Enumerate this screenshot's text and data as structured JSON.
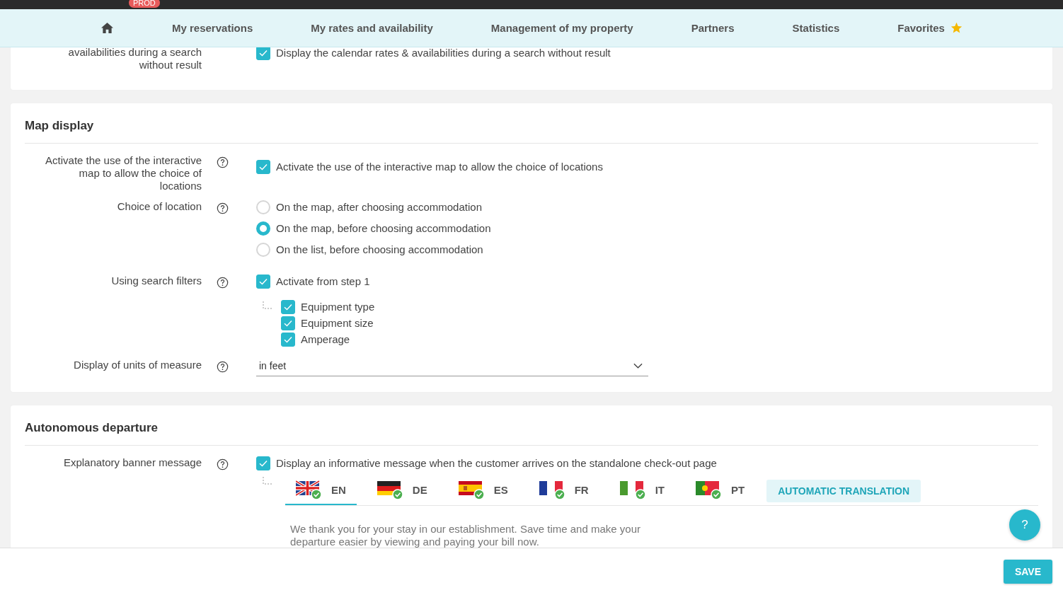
{
  "env_badge": "PROD",
  "nav": [
    {
      "kind": "home"
    },
    {
      "kind": "link",
      "label": "My reservations"
    },
    {
      "kind": "link",
      "label": "My rates and availability"
    },
    {
      "kind": "link",
      "label": "Management of my property"
    },
    {
      "kind": "link",
      "label": "Partners"
    },
    {
      "kind": "link",
      "label": "Statistics"
    },
    {
      "kind": "favorite",
      "label": "Favorites"
    }
  ],
  "sections": [
    {
      "rows": [
        {
          "label": "availabilities during a search without result",
          "help": false,
          "controls": [
            {
              "kind": "checkbox",
              "label": "Display the calendar rates & availabilities during a search without result",
              "checked": true
            }
          ]
        }
      ]
    },
    {
      "title": "Map display",
      "rows": [
        {
          "label": "Activate the use of the interactive map to allow the choice of locations",
          "help": true,
          "controls": [
            {
              "kind": "checkbox",
              "label": "Activate the use of the interactive map to allow the choice of locations",
              "checked": true
            }
          ]
        },
        {
          "label": "Choice of location",
          "help": true,
          "controls": [
            {
              "kind": "radio",
              "options": [
                {
                  "label": "On the map, after choosing accommodation",
                  "selected": false
                },
                {
                  "label": "On the map, before choosing accommodation",
                  "selected": true
                },
                {
                  "label": "On the list, before choosing accommodation",
                  "selected": false
                }
              ]
            }
          ]
        },
        {
          "label": "Using search filters",
          "help": true,
          "controls": [
            {
              "kind": "checkbox",
              "label": "Activate from step 1",
              "checked": true
            },
            {
              "kind": "subchecks",
              "items": [
                {
                  "label": "Equipment type",
                  "checked": true
                },
                {
                  "label": "Equipment size",
                  "checked": true
                },
                {
                  "label": "Amperage",
                  "checked": true
                }
              ]
            }
          ]
        },
        {
          "label": "Display of units of measure",
          "help": true,
          "controls": [
            {
              "kind": "select",
              "value": "in feet"
            }
          ]
        }
      ]
    },
    {
      "title": "Autonomous departure",
      "rows": [
        {
          "label": "Explanatory banner message",
          "help": true,
          "controls": [
            {
              "kind": "checkbox",
              "label": "Display an informative message when the customer arrives on the standalone check-out page",
              "checked": true
            },
            {
              "kind": "languages",
              "tabs": [
                {
                  "code": "EN",
                  "selected": true,
                  "done": true
                },
                {
                  "code": "DE",
                  "selected": false,
                  "done": true
                },
                {
                  "code": "ES",
                  "selected": false,
                  "done": true
                },
                {
                  "code": "FR",
                  "selected": false,
                  "done": true
                },
                {
                  "code": "IT",
                  "selected": false,
                  "done": true
                },
                {
                  "code": "PT",
                  "selected": false,
                  "done": true
                }
              ],
              "action": "AUTOMATIC TRANSLATION",
              "message": "We thank you for your stay in our establishment. Save time and make your departure easier by viewing and paying your bill now."
            }
          ]
        }
      ]
    }
  ],
  "help_button": "?",
  "save_button": "SAVE"
}
